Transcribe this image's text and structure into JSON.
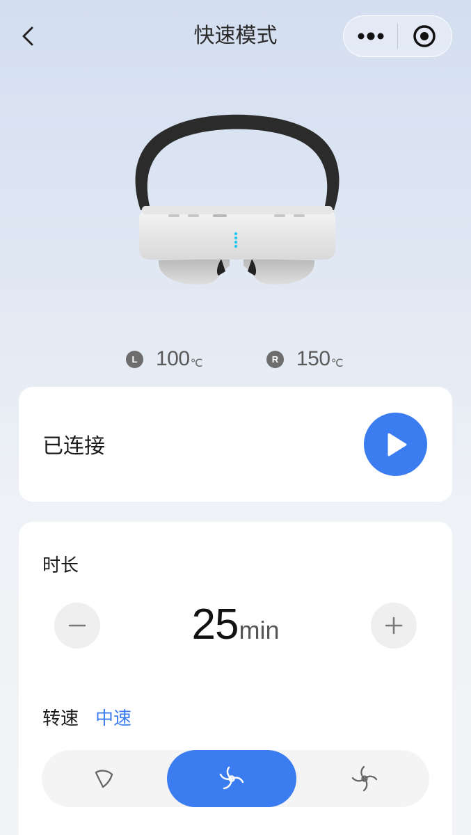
{
  "nav": {
    "title": "快速模式",
    "back_icon": "chevron-left-icon",
    "more_icon": "more-dots-icon",
    "close_icon": "target-icon"
  },
  "temperatures": {
    "left": {
      "badge": "L",
      "value": "100",
      "unit": "℃"
    },
    "right": {
      "badge": "R",
      "value": "150",
      "unit": "℃"
    }
  },
  "status": {
    "text": "已连接",
    "action_icon": "play-icon"
  },
  "settings": {
    "duration_label": "时长",
    "duration_value": "25",
    "duration_unit": "min",
    "speed_label": "转速",
    "speed_value": "中速",
    "speed_options": [
      {
        "icon": "fan-low-icon"
      },
      {
        "icon": "fan-mid-icon",
        "selected": true
      },
      {
        "icon": "fan-high-icon"
      }
    ]
  },
  "colors": {
    "accent": "#3b7cf0",
    "card": "#ffffff",
    "led": "#29c7f0"
  }
}
